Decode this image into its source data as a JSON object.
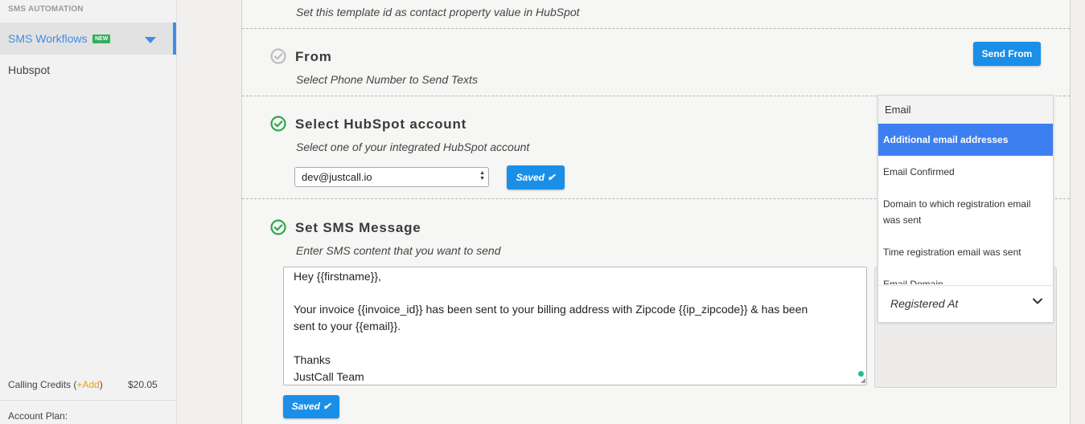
{
  "sidebar": {
    "section_label": "SMS AUTOMATION",
    "active_item": {
      "label": "SMS Workflows",
      "badge": "NEW"
    },
    "items": [
      {
        "label": "Hubspot"
      }
    ],
    "credits": {
      "label": "Calling Credits (",
      "add": "+Add",
      "close": ")",
      "amount": "$20.05"
    },
    "plan_label": "Account Plan:"
  },
  "main": {
    "top_hint": "Set this template id as contact property value in HubSpot",
    "from": {
      "title": "From",
      "hint": "Select Phone Number to Send Texts",
      "button": "Send From",
      "status": "incomplete"
    },
    "hubspot": {
      "title": "Select HubSpot account",
      "hint": "Select one of your integrated HubSpot account",
      "select_value": "dev@justcall.io",
      "button": "Saved ✔",
      "status": "complete"
    },
    "sms": {
      "title": "Set SMS Message",
      "hint": "Enter SMS content that you want to send",
      "message_lines": [
        "Hey {{firstname}},",
        "",
        "Your invoice {{invoice_id}} has been sent to your billing address with Zipcode {{ip_zipcode}} & has been",
        "sent to your {{email}}.",
        "",
        "Thanks",
        "JustCall Team"
      ],
      "button": "Saved ✔",
      "status": "complete"
    }
  },
  "property_dropdown": {
    "search_value": "Email",
    "options": [
      {
        "label": "Additional email addresses",
        "highlighted": true
      },
      {
        "label": "Email Confirmed",
        "highlighted": false
      },
      {
        "label": "Domain to which registration email was sent",
        "highlighted": false
      },
      {
        "label": "Time registration email was sent",
        "highlighted": false
      },
      {
        "label": "Email Domain",
        "highlighted": false
      }
    ],
    "selected_value": "Registered At"
  },
  "colors": {
    "accent": "#1a8fe8",
    "sidebar_active": "#3d8ee6",
    "check_green": "#2ca84c",
    "check_gray": "#bdbdbd",
    "highlight": "#3d7ff0",
    "badge_green": "#2db05c",
    "add_orange": "#f39c12"
  }
}
